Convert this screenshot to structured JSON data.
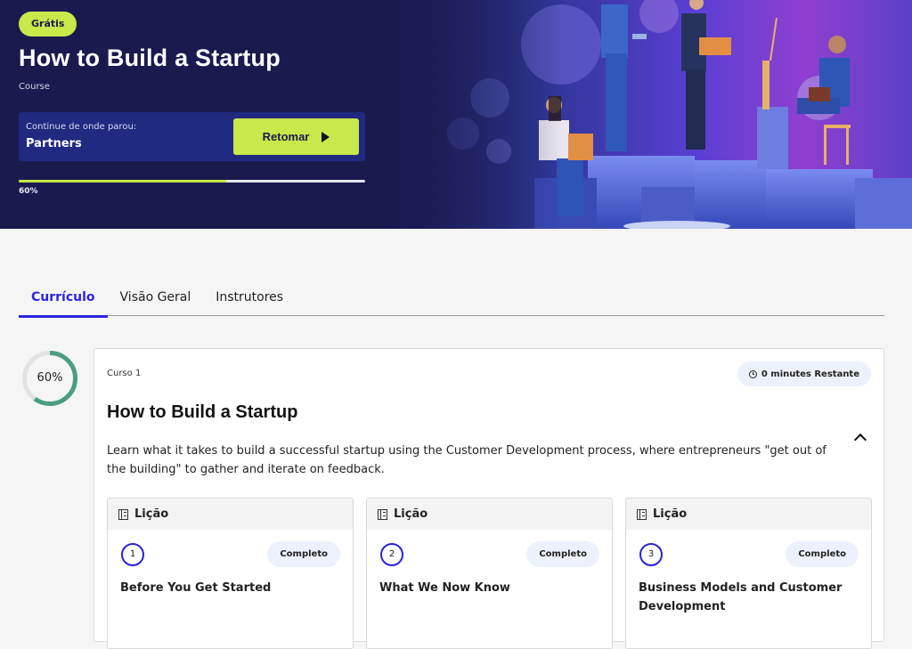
{
  "hero": {
    "badge": "Grátis",
    "title": "How to Build a Startup",
    "subtitle": "Course",
    "resume": {
      "label": "Continue de onde parou:",
      "lesson": "Partners",
      "button_label": "Retomar"
    },
    "progress_percent": 60,
    "progress_label": "60%",
    "colors": {
      "background": "#1b1a4f",
      "accent": "#c9e84a",
      "resume_box": "#1f2a80"
    }
  },
  "tabs": [
    {
      "label": "Currículo",
      "active": true
    },
    {
      "label": "Visão Geral",
      "active": false
    },
    {
      "label": "Instrutores",
      "active": false
    }
  ],
  "progress_ring": {
    "percent": 60,
    "label": "60%",
    "color": "#4a9e7f",
    "track_color": "#e2e2e2"
  },
  "course": {
    "number_label": "Curso 1",
    "time_remaining": "0 minutes Restante",
    "title": "How to Build a Startup",
    "description": "Learn what it takes to build a successful startup using the Customer Development process, where entrepreneurs \"get out of the building\" to gather and iterate on feedback.",
    "lessons": [
      {
        "type": "Lição",
        "number": "1",
        "status": "Completo",
        "title": "Before You Get Started"
      },
      {
        "type": "Lição",
        "number": "2",
        "status": "Completo",
        "title": "What We Now Know"
      },
      {
        "type": "Lição",
        "number": "3",
        "status": "Completo",
        "title": "Business Models and Customer Development"
      }
    ]
  },
  "accent_color": "#2e24e0"
}
